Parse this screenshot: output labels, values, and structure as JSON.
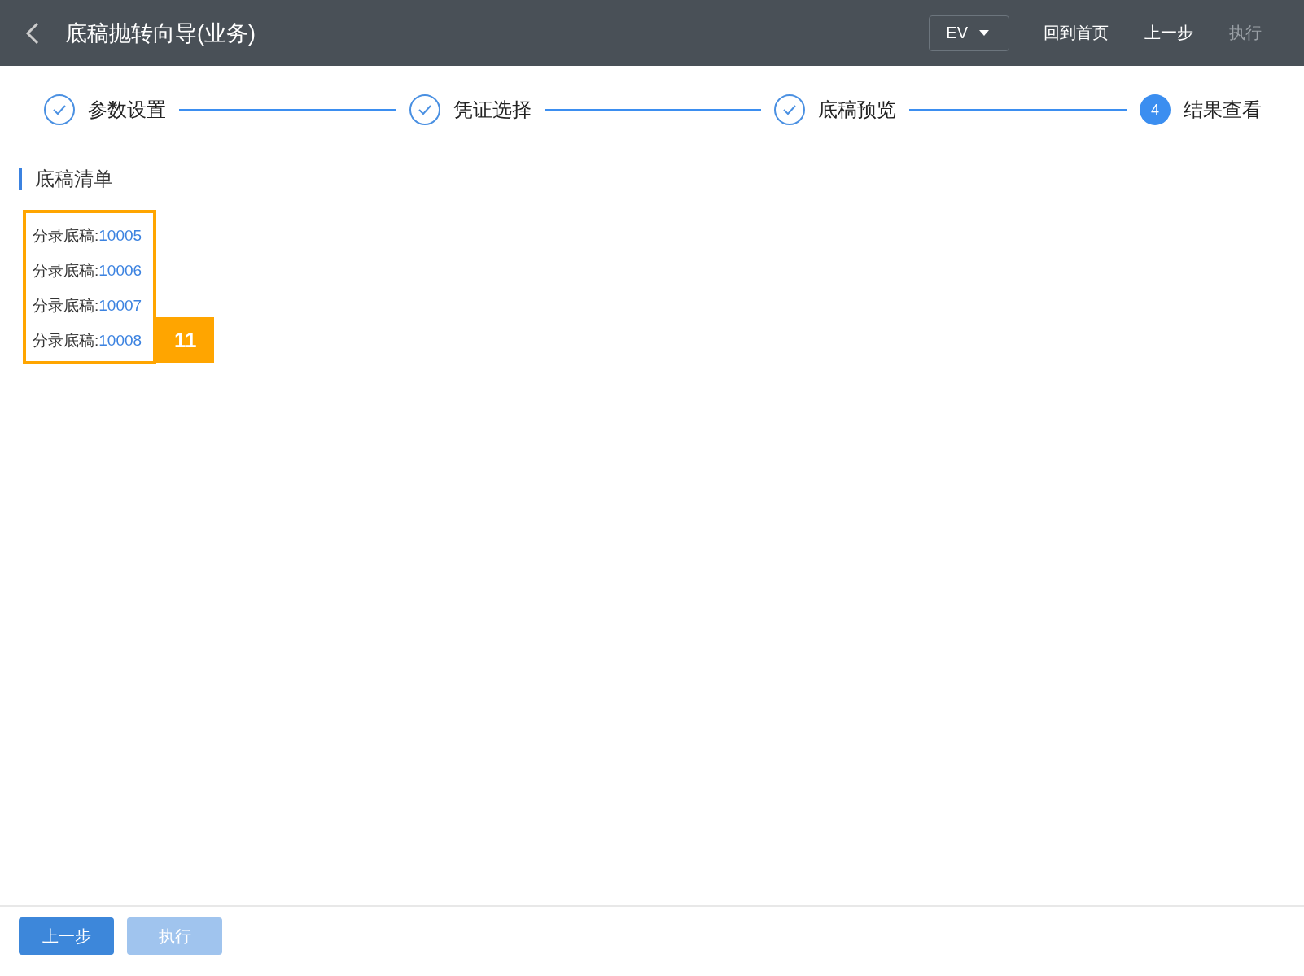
{
  "header": {
    "title": "底稿抛转向导(业务)",
    "dropdown": {
      "value": "EV"
    },
    "actions": [
      {
        "label": "回到首页",
        "disabled": false
      },
      {
        "label": "上一步",
        "disabled": false
      },
      {
        "label": "执行",
        "disabled": true
      }
    ]
  },
  "steps": [
    {
      "label": "参数设置",
      "done": true
    },
    {
      "label": "凭证选择",
      "done": true
    },
    {
      "label": "底稿预览",
      "done": true
    },
    {
      "label": "结果查看",
      "done": false,
      "number": "4"
    }
  ],
  "section": {
    "title": "底稿清单",
    "items": [
      {
        "label": "分录底稿:",
        "value": "10005"
      },
      {
        "label": "分录底稿:",
        "value": "10006"
      },
      {
        "label": "分录底稿:",
        "value": "10007"
      },
      {
        "label": "分录底稿:",
        "value": "10008"
      }
    ],
    "callout": {
      "label": "11"
    }
  },
  "footer": {
    "buttons": [
      {
        "label": "上一步",
        "disabled": false
      },
      {
        "label": "执行",
        "disabled": true
      }
    ]
  }
}
